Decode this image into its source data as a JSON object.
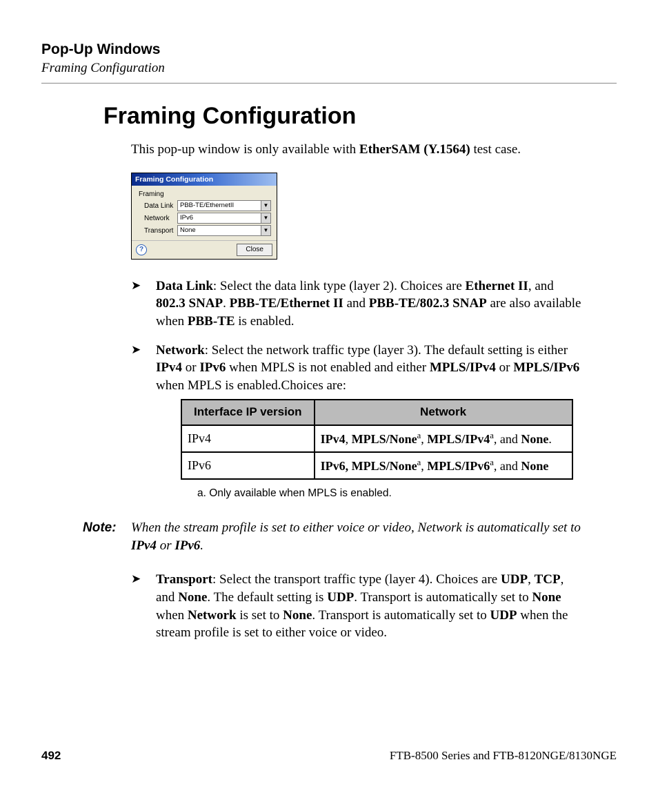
{
  "header": {
    "running_title": "Pop-Up Windows",
    "running_sub": "Framing Configuration"
  },
  "section_title": "Framing Configuration",
  "intro": {
    "pre": "This pop-up window is only available with ",
    "bold": "EtherSAM (Y.1564)",
    "post": " test case."
  },
  "dialog": {
    "title": "Framing Configuration",
    "group": "Framing",
    "rows": [
      {
        "label": "Data Link",
        "value": "PBB-TE/EthernetII"
      },
      {
        "label": "Network",
        "value": "IPv6"
      },
      {
        "label": "Transport",
        "value": "None"
      }
    ],
    "close": "Close"
  },
  "bullets": {
    "datalink": {
      "t1": "Data Link",
      "t2": ": Select the data link type (layer 2). Choices are ",
      "b1": "Ethernet II",
      "t3": ", and ",
      "b2": "802.3 SNAP",
      "t4": ". ",
      "b3": "PBB-TE/Ethernet II",
      "t5": " and ",
      "b4": "PBB-TE/802.3 SNAP",
      "t6": " are also available when ",
      "b5": "PBB-TE",
      "t7": " is enabled."
    },
    "network": {
      "t1": "Network",
      "t2": ": Select the network traffic type (layer 3). The default setting is either ",
      "b1": "IPv4",
      "t3": " or ",
      "b2": "IPv6",
      "t4": " when MPLS is not enabled and either ",
      "b3": "MPLS/IPv4",
      "t5": " or ",
      "b4": "MPLS/IPv6",
      "t6": " when MPLS is enabled.Choices are:"
    },
    "transport": {
      "t1": "Transport",
      "t2": ": Select the transport traffic type (layer 4). Choices are ",
      "b1": "UDP",
      "t3": ", ",
      "b2": "TCP",
      "t4": ", and ",
      "b3": "None",
      "t5": ". The default setting is ",
      "b4": "UDP",
      "t6": ". Transport is automatically set to ",
      "b5": "None",
      "t7": " when ",
      "b6": "Network",
      "t8": " is set to ",
      "b7": "None",
      "t9": ". Transport is automatically set to ",
      "b8": "UDP",
      "t10": " when the stream profile is set to either voice or video."
    }
  },
  "table": {
    "h1": "Interface IP version",
    "h2": "Network",
    "r1c1": "IPv4",
    "r1": {
      "b1": "IPv4",
      "t1": ", ",
      "b2": "MPLS/None",
      "t2": ", ",
      "b3": "MPLS/IPv4",
      "t3": ", and ",
      "b4": "None",
      "t4": "."
    },
    "r2c1": "IPv6",
    "r2": {
      "b1": "IPv6, MPLS/None",
      "t1": ", ",
      "b2": "MPLS/IPv6",
      "t2": ", and ",
      "b3": "None"
    }
  },
  "table_note": "a.   Only available when MPLS is enabled.",
  "note": {
    "label": "Note:",
    "t1": "When the stream profile is set to either voice or video, Network is automatically set to ",
    "b1": "IPv4",
    "t2": " or ",
    "b2": "IPv6",
    "t3": "."
  },
  "footer": {
    "page": "492",
    "doc": "FTB-8500 Series and FTB-8120NGE/8130NGE"
  },
  "sup_a": "a"
}
